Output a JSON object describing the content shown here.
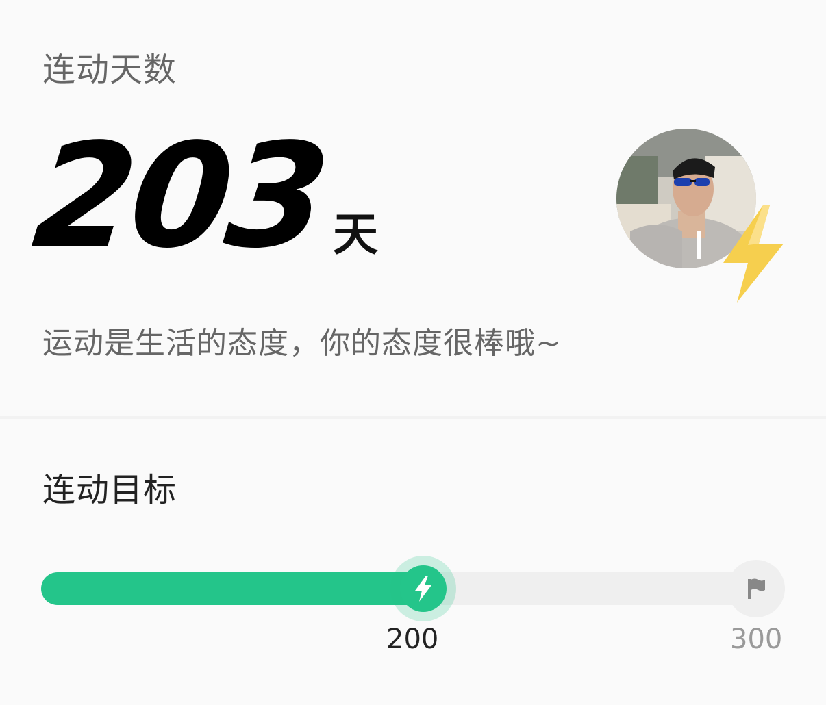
{
  "streak": {
    "label": "连动天数",
    "days": "203",
    "unit": "天",
    "motto": "运动是生活的态度，你的态度很棒哦~"
  },
  "goal": {
    "label": "连动目标",
    "current_value": "200",
    "target_value": "300",
    "progress_fraction": 0.5
  },
  "icons": {
    "badge": "lightning-bolt-icon",
    "current_marker": "lightning-bolt-icon",
    "target_marker": "flag-icon"
  },
  "colors": {
    "accent_green": "#24c58a",
    "track_gray": "#efefef",
    "badge_yellow": "#f6cf4e",
    "label_gray": "#666666"
  }
}
